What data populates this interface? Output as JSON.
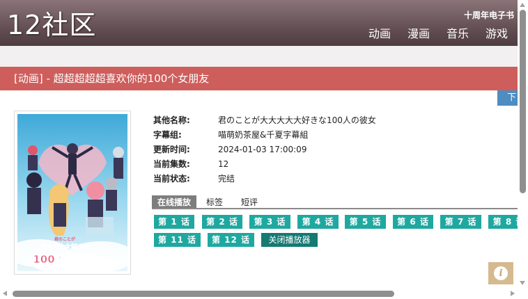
{
  "header": {
    "logo": "12社区",
    "anniversary_link": "十周年电子书",
    "nav": [
      "动画",
      "漫画",
      "音乐",
      "游戏"
    ]
  },
  "title": "[动画] - 超超超超超喜欢你的100个女朋友",
  "download_label": "下",
  "poster": {
    "title_art_lines": [
      "君のことが",
      "大大大大大好きな",
      "100人の彼女"
    ]
  },
  "details": [
    {
      "label": "其他名称:",
      "value": "君のことが大大大大大好きな100人の彼女"
    },
    {
      "label": "字幕组:",
      "value": "喵萌奶茶屋&千夏字幕組"
    },
    {
      "label": "更新时间:",
      "value": "2024-01-03 17:00:09"
    },
    {
      "label": "当前集数:",
      "value": "12"
    },
    {
      "label": "当前状态:",
      "value": "完结"
    }
  ],
  "tabs": [
    {
      "label": "在线播放",
      "active": true
    },
    {
      "label": "标签",
      "active": false
    },
    {
      "label": "短评",
      "active": false
    }
  ],
  "episodes": [
    "第 1 话",
    "第 2 话",
    "第 3 话",
    "第 4 话",
    "第 5 话",
    "第 6 话",
    "第 7 话",
    "第 8 话",
    "第 11 话",
    "第 12 话"
  ],
  "close_player_label": "关闭播放器",
  "info_icon_glyph": "i",
  "colors": {
    "header": "#5e4a4f",
    "title_bar": "#cd5e5c",
    "episode_button": "#1fa8a0",
    "close_button": "#147a72",
    "download_button": "#4d8dc0"
  }
}
